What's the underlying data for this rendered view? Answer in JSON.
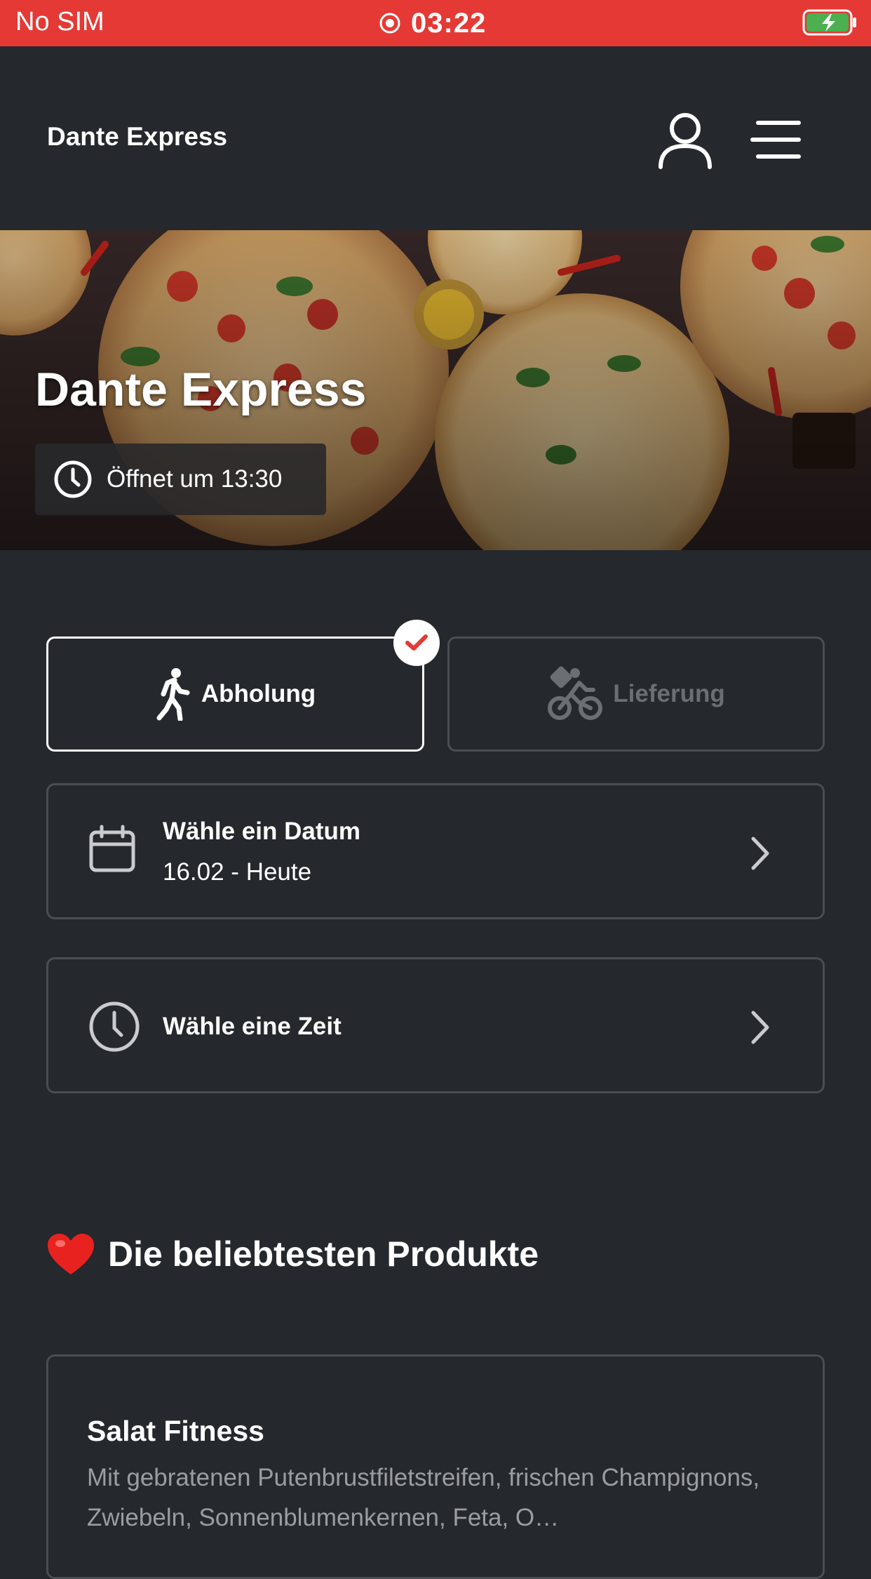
{
  "status_bar": {
    "carrier": "No SIM",
    "time": "03:22",
    "battery_color": "#4caf50"
  },
  "header": {
    "title": "Dante Express",
    "user_icon": "user-icon",
    "menu_icon": "menu-icon"
  },
  "hero": {
    "title": "Dante Express",
    "opening_text": "Öffnet um 13:30"
  },
  "order_mode": {
    "pickup_label": "Abholung",
    "delivery_label": "Lieferung",
    "selected": "pickup"
  },
  "date_selector": {
    "label": "Wähle ein Datum",
    "value": "16.02 - Heute"
  },
  "time_selector": {
    "label": "Wähle eine Zeit"
  },
  "popular": {
    "title": "Die beliebtesten Produkte",
    "products": [
      {
        "name": "Salat Fitness",
        "description": "Mit gebratenen Putenbrustfiletstreifen, frischen Champignons, Zwiebeln, Sonnenblumenkernen, Feta, O…"
      }
    ]
  },
  "colors": {
    "accent": "#e53935",
    "background": "#25282c",
    "border": "#4a4d52",
    "muted_text": "#9a9da1"
  }
}
